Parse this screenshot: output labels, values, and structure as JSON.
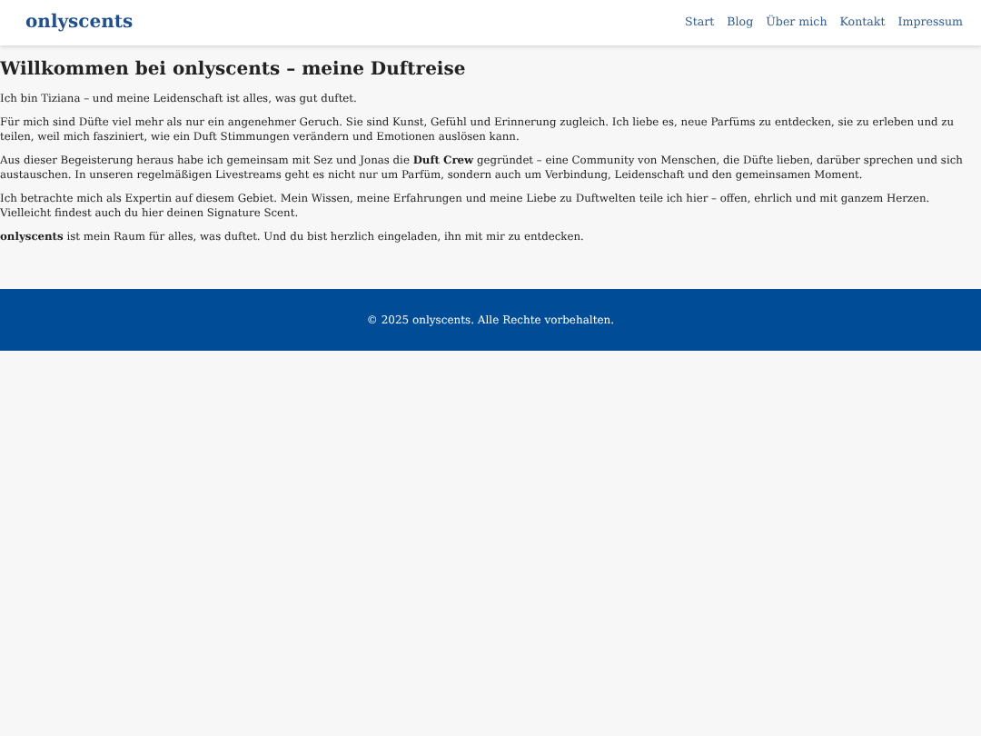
{
  "header": {
    "logo": "onlyscents",
    "nav": [
      {
        "label": "Start"
      },
      {
        "label": "Blog"
      },
      {
        "label": "Über mich"
      },
      {
        "label": "Kontakt"
      },
      {
        "label": "Impressum"
      }
    ]
  },
  "main": {
    "title": "Willkommen bei onlyscents – meine Duftreise",
    "paragraphs": [
      "Ich bin Tiziana – und meine Leidenschaft ist alles, was gut duftet.",
      "Für mich sind Düfte viel mehr als nur ein angenehmer Geruch. Sie sind Kunst, Gefühl und Erinnerung zugleich. Ich liebe es, neue Parfüms zu entdecken, sie zu erleben und zu teilen, weil mich fasziniert, wie ein Duft Stimmungen verändern und Emotionen auslösen kann.",
      "Aus dieser Begeisterung heraus habe ich gemeinsam mit Sez und Jonas die **Duft Crew** gegründet – eine Community von Menschen, die Düfte lieben, darüber sprechen und sich austauschen. In unseren regelmäßigen Livestreams geht es nicht nur um Parfüm, sondern auch um Verbindung, Leidenschaft und den gemeinsamen Moment.",
      "Ich betrachte mich als Expertin auf diesem Gebiet. Mein Wissen, meine Erfahrungen und meine Liebe zu Duftwelten teile ich hier – offen, ehrlich und mit ganzem Herzen. Vielleicht findest auch du hier deinen Signature Scent.",
      "**onlyscents** ist mein Raum für alles, was duftet. Und du bist herzlich eingeladen, ihn mit mir zu entdecken."
    ]
  },
  "footer": {
    "text": "© 2025 onlyscents. Alle Rechte vorbehalten."
  }
}
